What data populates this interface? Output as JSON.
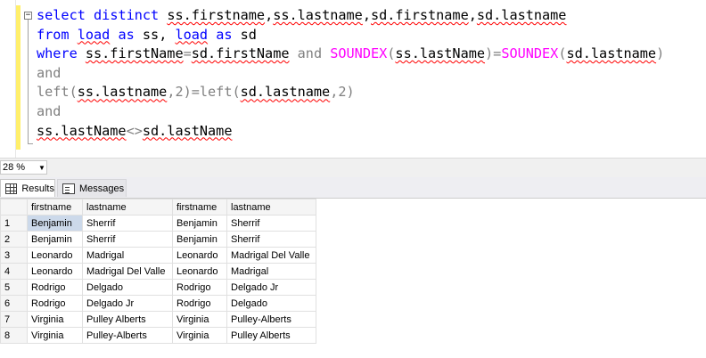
{
  "editor": {
    "lines": [
      [
        {
          "t": "select",
          "c": "kw"
        },
        {
          "t": " "
        },
        {
          "t": "distinct",
          "c": "kw"
        },
        {
          "t": " "
        },
        {
          "t": "ss.firstname",
          "s": true
        },
        {
          "t": ","
        },
        {
          "t": "ss.lastname",
          "s": true
        },
        {
          "t": ","
        },
        {
          "t": "sd.firstname",
          "s": true
        },
        {
          "t": ","
        },
        {
          "t": "sd.lastname",
          "s": true
        }
      ],
      [
        {
          "t": "from",
          "c": "kw"
        },
        {
          "t": " "
        },
        {
          "t": "load",
          "c": "kw",
          "s": true
        },
        {
          "t": " "
        },
        {
          "t": "as",
          "c": "kw"
        },
        {
          "t": " ss, "
        },
        {
          "t": "load",
          "c": "kw",
          "s": true
        },
        {
          "t": " "
        },
        {
          "t": "as",
          "c": "kw"
        },
        {
          "t": " sd"
        }
      ],
      [
        {
          "t": "where",
          "c": "kw"
        },
        {
          "t": " "
        },
        {
          "t": "ss.firstName",
          "s": true
        },
        {
          "t": "=",
          "c": "gray"
        },
        {
          "t": "sd.firstName",
          "s": true
        },
        {
          "t": " "
        },
        {
          "t": "and",
          "c": "gray"
        },
        {
          "t": " "
        },
        {
          "t": "SOUNDEX",
          "c": "fn"
        },
        {
          "t": "(",
          "c": "gray"
        },
        {
          "t": "ss.lastName",
          "s": true
        },
        {
          "t": ")=",
          "c": "gray"
        },
        {
          "t": "SOUNDEX",
          "c": "fn"
        },
        {
          "t": "(",
          "c": "gray"
        },
        {
          "t": "sd.lastname",
          "s": true
        },
        {
          "t": ")",
          "c": "gray"
        }
      ],
      [
        {
          "t": "and",
          "c": "gray"
        }
      ],
      [
        {
          "t": "left(",
          "c": "gray"
        },
        {
          "t": "ss.lastname",
          "s": true
        },
        {
          "t": ",2)=left(",
          "c": "gray"
        },
        {
          "t": "sd.lastname",
          "s": true
        },
        {
          "t": ",2)",
          "c": "gray"
        }
      ],
      [
        {
          "t": "and",
          "c": "gray"
        }
      ],
      [
        {
          "t": "ss.lastName",
          "s": true
        },
        {
          "t": "<>",
          "c": "gray"
        },
        {
          "t": "sd.lastName",
          "s": true
        }
      ]
    ],
    "collapse_symbol": "−"
  },
  "zoom": {
    "value": "28 %",
    "arrow": "▼"
  },
  "tabs": {
    "results": "Results",
    "messages": "Messages"
  },
  "results": {
    "headers": [
      "firstname",
      "lastname",
      "firstname",
      "lastname"
    ],
    "rows": [
      [
        "1",
        "Benjamin",
        "Sherrif",
        "Benjamin",
        "Sherrif"
      ],
      [
        "2",
        "Benjamin",
        "Sherrif",
        "Benjamin",
        "Sherrif"
      ],
      [
        "3",
        "Leonardo",
        "Madrigal",
        "Leonardo",
        "Madrigal Del Valle"
      ],
      [
        "4",
        "Leonardo",
        "Madrigal Del Valle",
        "Leonardo",
        "Madrigal"
      ],
      [
        "5",
        "Rodrigo",
        "Delgado",
        "Rodrigo",
        "Delgado Jr"
      ],
      [
        "6",
        "Rodrigo",
        "Delgado Jr",
        "Rodrigo",
        "Delgado"
      ],
      [
        "7",
        "Virginia",
        "Pulley Alberts",
        "Virginia",
        "Pulley-Alberts"
      ],
      [
        "8",
        "Virginia",
        "Pulley-Alberts",
        "Virginia",
        "Pulley Alberts"
      ]
    ]
  }
}
